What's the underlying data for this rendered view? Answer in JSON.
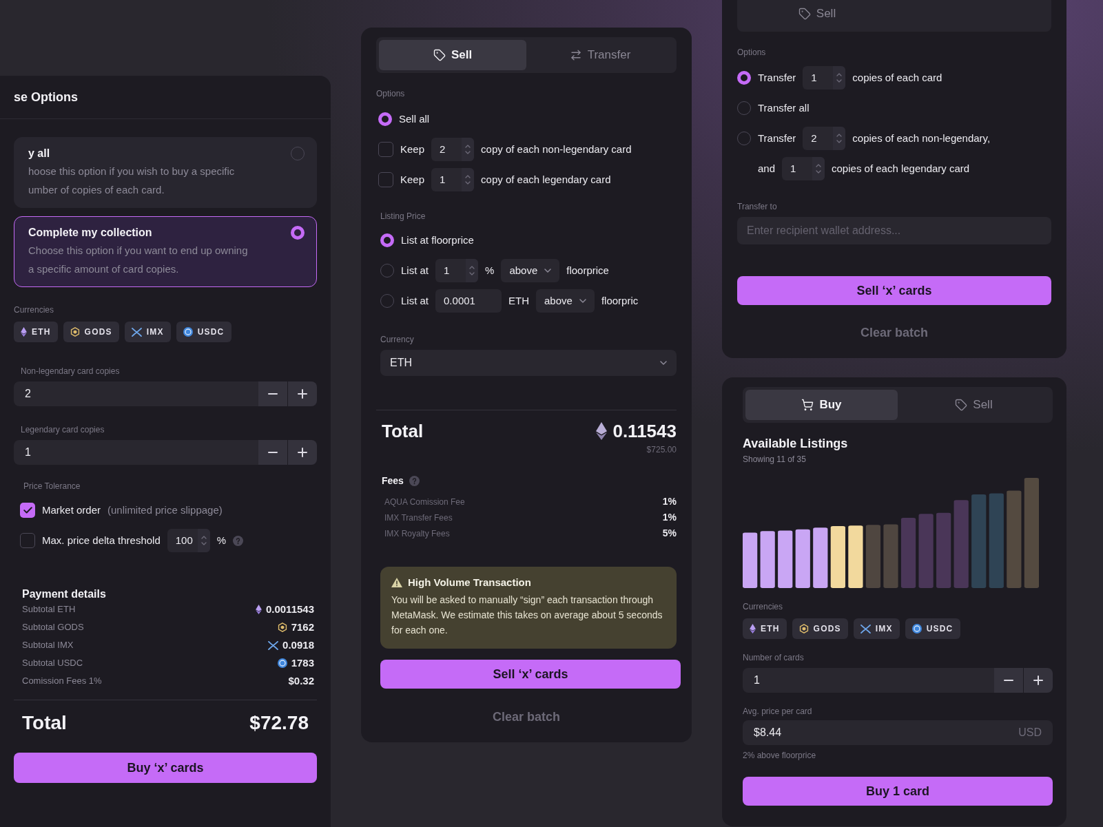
{
  "purchase_panel": {
    "title": "se Options",
    "options": [
      {
        "title": "y all",
        "description_lines": [
          "hoose this option if you wish to buy a specific",
          "umber of copies of each card."
        ],
        "selected": false
      },
      {
        "title": "Complete my collection",
        "description_lines": [
          "Choose this option if you want to end up owning",
          "a specific amount of card copies."
        ],
        "selected": true
      }
    ],
    "currencies_label": "Currencies",
    "currencies": [
      {
        "code": "ETH",
        "kind": "eth"
      },
      {
        "code": "GODS",
        "kind": "gods"
      },
      {
        "code": "IMX",
        "kind": "imx"
      },
      {
        "code": "USDC",
        "kind": "usdc"
      }
    ],
    "non_legendary": {
      "label": "Non-legendary card copies",
      "value": "2"
    },
    "legendary": {
      "label": "Legendary card copies",
      "value": "1"
    },
    "price_tolerance_label": "Price Tolerance",
    "market_order": {
      "label": "Market order",
      "note": "(unlimited price slippage)",
      "checked": true
    },
    "max_delta": {
      "label": "Max. price delta threshold",
      "value": "100",
      "unit": "%",
      "checked": false
    },
    "payment": {
      "title": "Payment details",
      "rows": [
        {
          "label": "Subtotal ETH",
          "value": "0.0011543",
          "kind": "eth"
        },
        {
          "label": "Subtotal GODS",
          "value": "7162",
          "kind": "gods"
        },
        {
          "label": "Subtotal IMX",
          "value": "0.0918",
          "kind": "imx"
        },
        {
          "label": "Subtotal USDC",
          "value": "1783",
          "kind": "usdc"
        },
        {
          "label": "Comission Fees 1%",
          "value": "$0.32",
          "kind": "fiat"
        }
      ]
    },
    "total": {
      "label": "Total",
      "value": "$72.78"
    },
    "button": "Buy ‘x’ cards"
  },
  "sell_panel": {
    "tabs": [
      {
        "label": "Sell",
        "kind": "tag",
        "selected": true
      },
      {
        "label": "Transfer",
        "kind": "transfer",
        "selected": false
      }
    ],
    "options_label": "Options",
    "options": [
      {
        "kind": "radio",
        "label": "Sell all",
        "checked": true
      },
      {
        "kind": "checkbox",
        "label": "Keep",
        "value": "2",
        "suffix": "copy of each non-legendary card",
        "checked": false
      },
      {
        "kind": "checkbox",
        "label": "Keep",
        "value": "1",
        "suffix": "copy of each legendary card",
        "checked": false
      }
    ],
    "listing_label": "Listing Price",
    "listing_options": [
      {
        "kind": "floor",
        "label": "List at floorprice",
        "selected": true
      },
      {
        "kind": "percent",
        "label": "List at",
        "value": "1",
        "unit": "%",
        "direction": "above",
        "suffix": "floorprice",
        "selected": false
      },
      {
        "kind": "fixed",
        "label": "List at",
        "value": "0.0001",
        "unit": "ETH",
        "direction": "above",
        "suffix": "floorpric",
        "selected": false
      }
    ],
    "currency": {
      "label": "Currency",
      "value": "ETH"
    },
    "total": {
      "label": "Total",
      "amount": "0.11543",
      "usd": "$725.00"
    },
    "fees": {
      "title": "Fees",
      "rows": [
        {
          "label": "AQUA Comission Fee",
          "value": "1%"
        },
        {
          "label": "IMX Transfer Fees",
          "value": "1%"
        },
        {
          "label": "IMX Royalty Fees",
          "value": "5%"
        }
      ]
    },
    "warning": {
      "title": "High Volume Transaction",
      "text": "You will be asked to manually “sign” each transaction through MetaMask. We estimate this takes on average about 5 seconds for each one."
    },
    "button": "Sell ‘x’ cards",
    "secondary_button": "Clear batch"
  },
  "transfer_panel": {
    "tabs": [
      {
        "label": "Sell",
        "kind": "tag",
        "selected": false
      }
    ],
    "options_label": "Options",
    "options": [
      {
        "label": "Transfer",
        "value": "1",
        "suffix": "copies of each card",
        "selected": true
      },
      {
        "label": "Transfer all",
        "selected": false
      },
      {
        "label": "Transfer",
        "value": "2",
        "suffix": "copies of each non-legendary,",
        "selected": false,
        "second_line": {
          "label": "and",
          "value": "1",
          "suffix": "copies of each legendary card"
        }
      }
    ],
    "transfer_to": {
      "label": "Transfer to",
      "placeholder": "Enter recipient wallet address..."
    },
    "button": "Sell ‘x’ cards",
    "secondary_button": "Clear batch"
  },
  "buy_panel": {
    "tabs": [
      {
        "label": "Buy",
        "kind": "cart",
        "selected": true
      },
      {
        "label": "Sell",
        "kind": "tag",
        "selected": false
      }
    ],
    "listings": {
      "title": "Available Listings",
      "subtitle": "Showing 11 of 35"
    },
    "currencies_label": "Currencies",
    "currencies": [
      {
        "code": "ETH",
        "kind": "eth"
      },
      {
        "code": "GODS",
        "kind": "gods"
      },
      {
        "code": "IMX",
        "kind": "imx"
      },
      {
        "code": "USDC",
        "kind": "usdc"
      }
    ],
    "number_of_cards": {
      "label": "Number of cards",
      "value": "1"
    },
    "avg_price": {
      "label": "Avg. price per card",
      "value": "$8.44",
      "unit": "USD",
      "note": "2% above floorprice"
    },
    "button": "Buy 1 card"
  }
}
